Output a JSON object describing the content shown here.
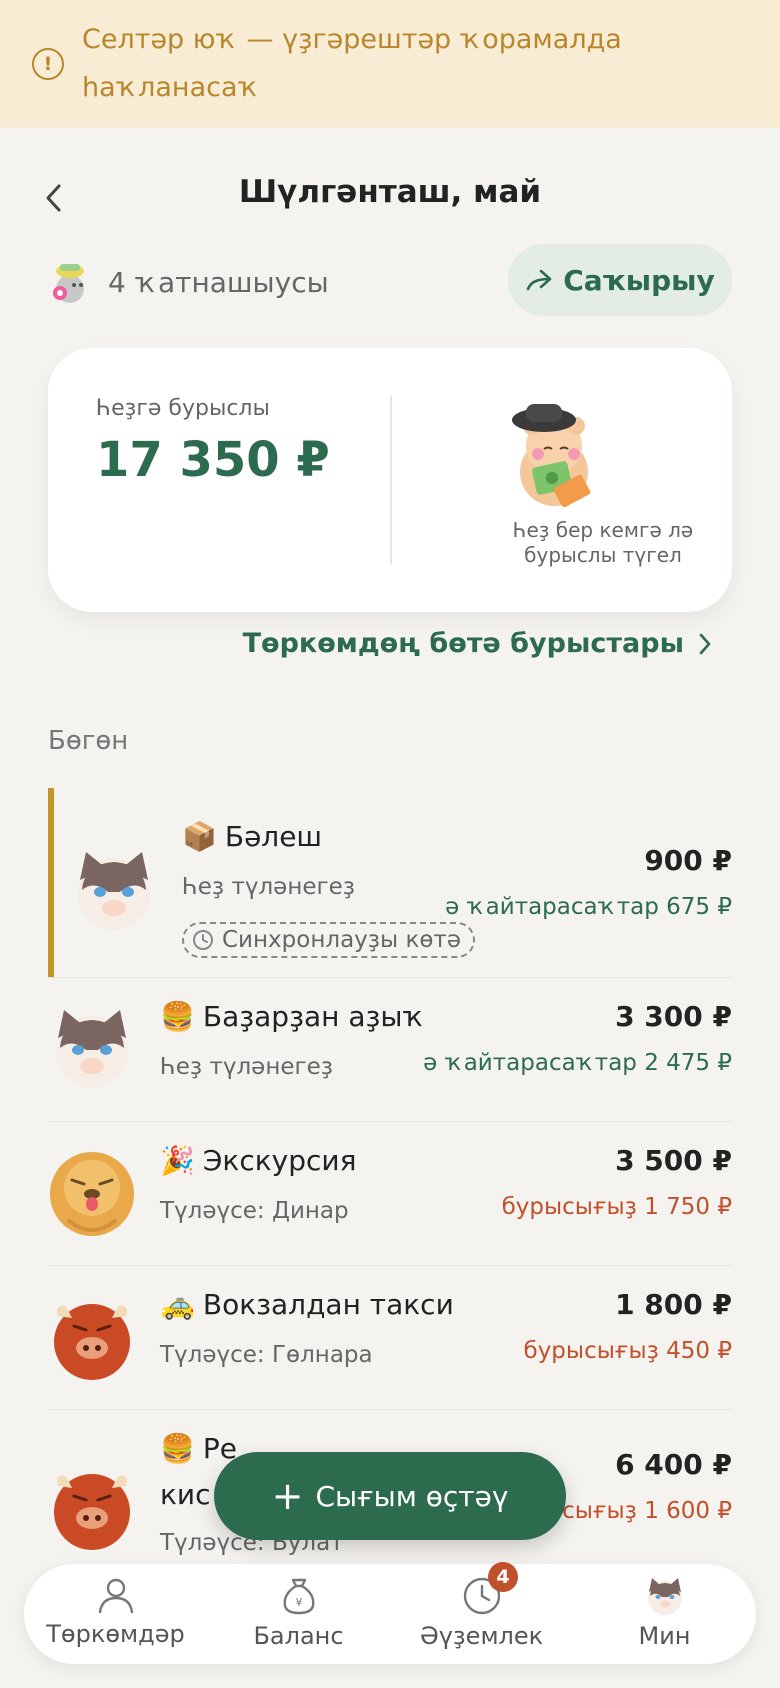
{
  "banner": {
    "text_line1": "Селтәр юҡ — үҙгәрештәр ҡорамалда",
    "text_line2": "һаҡланасаҡ"
  },
  "header": {
    "title": "Шүлгәнташ, май"
  },
  "participants": {
    "label": "4 ҡатнашыусы"
  },
  "invite": {
    "label": "Саҡырыу"
  },
  "balance": {
    "label": "Һеҙгә бурыслы",
    "amount": "17 350 ₽",
    "note_line1": "Һеҙ бер кемгә лә",
    "note_line2": "бурыслы түгел"
  },
  "all_debts_link": {
    "label": "Төркөмдөң бөтә бурыстары"
  },
  "sections": {
    "today": "Бөгөн"
  },
  "expenses": [
    {
      "emoji": "📦",
      "title": "Бәлеш",
      "subtitle": "Һеҙ түләнегеҙ",
      "chip": "Синхронлауҙы көтә",
      "amount": "900 ₽",
      "status": "ә ҡайтарасаҡтар 675 ₽",
      "status_color": "green",
      "avatar": "cat"
    },
    {
      "emoji": "🍔",
      "title": "Баҙарҙан аҙыҡ",
      "subtitle": "Һеҙ түләнегеҙ",
      "amount": "3 300 ₽",
      "status": "ә ҡайтарасаҡтар 2 475 ₽",
      "status_color": "green",
      "avatar": "cat"
    },
    {
      "emoji": "🎉",
      "title": "Экскурсия",
      "subtitle": "Түләүсе: Динар",
      "amount": "3 500 ₽",
      "status": "бурысығыҙ 1 750 ₽",
      "status_color": "red",
      "avatar": "dog"
    },
    {
      "emoji": "🚕",
      "title": "Вокзалдан такси",
      "subtitle": "Түләүсе: Гөлнара",
      "amount": "1 800 ₽",
      "status": "бурысығыҙ 450 ₽",
      "status_color": "red",
      "avatar": "bull"
    },
    {
      "emoji": "🍔",
      "title_line1": "Ре",
      "title_line2": "кис",
      "subtitle": "Түләүсе: Булат",
      "amount": "6 400 ₽",
      "status": "бурысығыҙ 1 600 ₽",
      "status_color": "red",
      "avatar": "bull"
    }
  ],
  "fab": {
    "label": "Сығым өҫтәү"
  },
  "nav": {
    "groups": "Төркөмдәр",
    "balance": "Баланс",
    "events": "Әүҙемлек",
    "events_badge": "4",
    "me": "Мин"
  },
  "colors": {
    "primary": "#2d6b4f",
    "banner_bg": "#f9ecd5",
    "banner_text": "#b8862b",
    "debt_red": "#c1502d",
    "background": "#f5f3ef"
  }
}
